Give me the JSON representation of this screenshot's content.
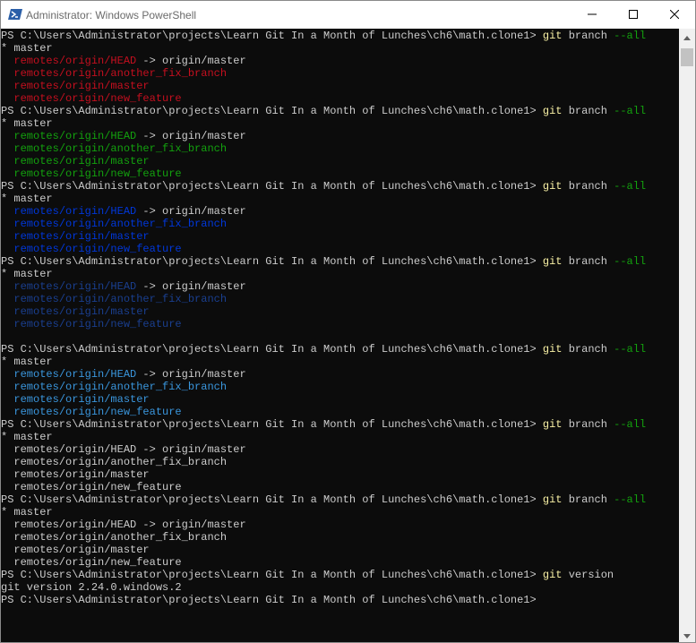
{
  "window": {
    "title": "Administrator: Windows PowerShell",
    "icon": "powershell-icon",
    "controls": [
      "minimize-icon",
      "maximize-icon",
      "close-icon"
    ]
  },
  "colors": {
    "background": "#0c0c0c",
    "default_text": "#cccccc",
    "command": "#f9f1a5",
    "parameter": "#13a10e",
    "red": "#c50f1f",
    "green": "#13a10e",
    "blue": "#0037da",
    "darkblue": "#1a3f8f",
    "cyan": "#3a96dd",
    "titlebar": "#ffffff"
  },
  "terminal": {
    "lines": [
      [
        {
          "t": "PS C:\\Users\\Administrator\\projects\\Learn Git In a Month of Lunches\\ch6\\math.clone1> "
        },
        {
          "t": "git",
          "c": "command"
        },
        {
          "t": " branch "
        },
        {
          "t": "--all",
          "c": "parameter"
        }
      ],
      [
        {
          "t": "* master"
        }
      ],
      [
        {
          "t": "  "
        },
        {
          "t": "remotes/origin/HEAD",
          "c": "red"
        },
        {
          "t": " -> origin/master"
        }
      ],
      [
        {
          "t": "  "
        },
        {
          "t": "remotes/origin/another_fix_branch",
          "c": "red"
        }
      ],
      [
        {
          "t": "  "
        },
        {
          "t": "remotes/origin/master",
          "c": "red"
        }
      ],
      [
        {
          "t": "  "
        },
        {
          "t": "remotes/origin/new_feature",
          "c": "red"
        }
      ],
      [
        {
          "t": "PS C:\\Users\\Administrator\\projects\\Learn Git In a Month of Lunches\\ch6\\math.clone1> "
        },
        {
          "t": "git",
          "c": "command"
        },
        {
          "t": " branch "
        },
        {
          "t": "--all",
          "c": "parameter"
        }
      ],
      [
        {
          "t": "* master"
        }
      ],
      [
        {
          "t": "  "
        },
        {
          "t": "remotes/origin/HEAD",
          "c": "green"
        },
        {
          "t": " -> origin/master"
        }
      ],
      [
        {
          "t": "  "
        },
        {
          "t": "remotes/origin/another_fix_branch",
          "c": "green"
        }
      ],
      [
        {
          "t": "  "
        },
        {
          "t": "remotes/origin/master",
          "c": "green"
        }
      ],
      [
        {
          "t": "  "
        },
        {
          "t": "remotes/origin/new_feature",
          "c": "green"
        }
      ],
      [
        {
          "t": "PS C:\\Users\\Administrator\\projects\\Learn Git In a Month of Lunches\\ch6\\math.clone1> "
        },
        {
          "t": "git",
          "c": "command"
        },
        {
          "t": " branch "
        },
        {
          "t": "--all",
          "c": "parameter"
        }
      ],
      [
        {
          "t": "* master"
        }
      ],
      [
        {
          "t": "  "
        },
        {
          "t": "remotes/origin/HEAD",
          "c": "blue"
        },
        {
          "t": " -> origin/master"
        }
      ],
      [
        {
          "t": "  "
        },
        {
          "t": "remotes/origin/another_fix_branch",
          "c": "blue"
        }
      ],
      [
        {
          "t": "  "
        },
        {
          "t": "remotes/origin/master",
          "c": "blue"
        }
      ],
      [
        {
          "t": "  "
        },
        {
          "t": "remotes/origin/new_feature",
          "c": "blue"
        }
      ],
      [
        {
          "t": "PS C:\\Users\\Administrator\\projects\\Learn Git In a Month of Lunches\\ch6\\math.clone1> "
        },
        {
          "t": "git",
          "c": "command"
        },
        {
          "t": " branch "
        },
        {
          "t": "--all",
          "c": "parameter"
        }
      ],
      [
        {
          "t": "* master"
        }
      ],
      [
        {
          "t": "  "
        },
        {
          "t": "remotes/origin/HEAD",
          "c": "darkblue"
        },
        {
          "t": " -> origin/master"
        }
      ],
      [
        {
          "t": "  "
        },
        {
          "t": "remotes/origin/another_fix_branch",
          "c": "darkblue"
        }
      ],
      [
        {
          "t": "  "
        },
        {
          "t": "remotes/origin/master",
          "c": "darkblue"
        }
      ],
      [
        {
          "t": "  "
        },
        {
          "t": "remotes/origin/new_feature",
          "c": "darkblue"
        }
      ],
      [
        {
          "t": ""
        }
      ],
      [
        {
          "t": "PS C:\\Users\\Administrator\\projects\\Learn Git In a Month of Lunches\\ch6\\math.clone1> "
        },
        {
          "t": "git",
          "c": "command"
        },
        {
          "t": " branch "
        },
        {
          "t": "--all",
          "c": "parameter"
        }
      ],
      [
        {
          "t": "* master"
        }
      ],
      [
        {
          "t": "  "
        },
        {
          "t": "remotes/origin/HEAD",
          "c": "cyan"
        },
        {
          "t": " -> origin/master"
        }
      ],
      [
        {
          "t": "  "
        },
        {
          "t": "remotes/origin/another_fix_branch",
          "c": "cyan"
        }
      ],
      [
        {
          "t": "  "
        },
        {
          "t": "remotes/origin/master",
          "c": "cyan"
        }
      ],
      [
        {
          "t": "  "
        },
        {
          "t": "remotes/origin/new_feature",
          "c": "cyan"
        }
      ],
      [
        {
          "t": "PS C:\\Users\\Administrator\\projects\\Learn Git In a Month of Lunches\\ch6\\math.clone1> "
        },
        {
          "t": "git",
          "c": "command"
        },
        {
          "t": " branch "
        },
        {
          "t": "--all",
          "c": "parameter"
        }
      ],
      [
        {
          "t": "* master"
        }
      ],
      [
        {
          "t": "  remotes/origin/HEAD -> origin/master"
        }
      ],
      [
        {
          "t": "  remotes/origin/another_fix_branch"
        }
      ],
      [
        {
          "t": "  remotes/origin/master"
        }
      ],
      [
        {
          "t": "  remotes/origin/new_feature"
        }
      ],
      [
        {
          "t": "PS C:\\Users\\Administrator\\projects\\Learn Git In a Month of Lunches\\ch6\\math.clone1> "
        },
        {
          "t": "git",
          "c": "command"
        },
        {
          "t": " branch "
        },
        {
          "t": "--all",
          "c": "parameter"
        }
      ],
      [
        {
          "t": "* master"
        }
      ],
      [
        {
          "t": "  remotes/origin/HEAD -> origin/master"
        }
      ],
      [
        {
          "t": "  remotes/origin/another_fix_branch"
        }
      ],
      [
        {
          "t": "  remotes/origin/master"
        }
      ],
      [
        {
          "t": "  remotes/origin/new_feature"
        }
      ],
      [
        {
          "t": "PS C:\\Users\\Administrator\\projects\\Learn Git In a Month of Lunches\\ch6\\math.clone1> "
        },
        {
          "t": "git",
          "c": "command"
        },
        {
          "t": " version"
        }
      ],
      [
        {
          "t": "git version 2.24.0.windows.2"
        }
      ],
      [
        {
          "t": "PS C:\\Users\\Administrator\\projects\\Learn Git In a Month of Lunches\\ch6\\math.clone1>"
        }
      ]
    ]
  }
}
